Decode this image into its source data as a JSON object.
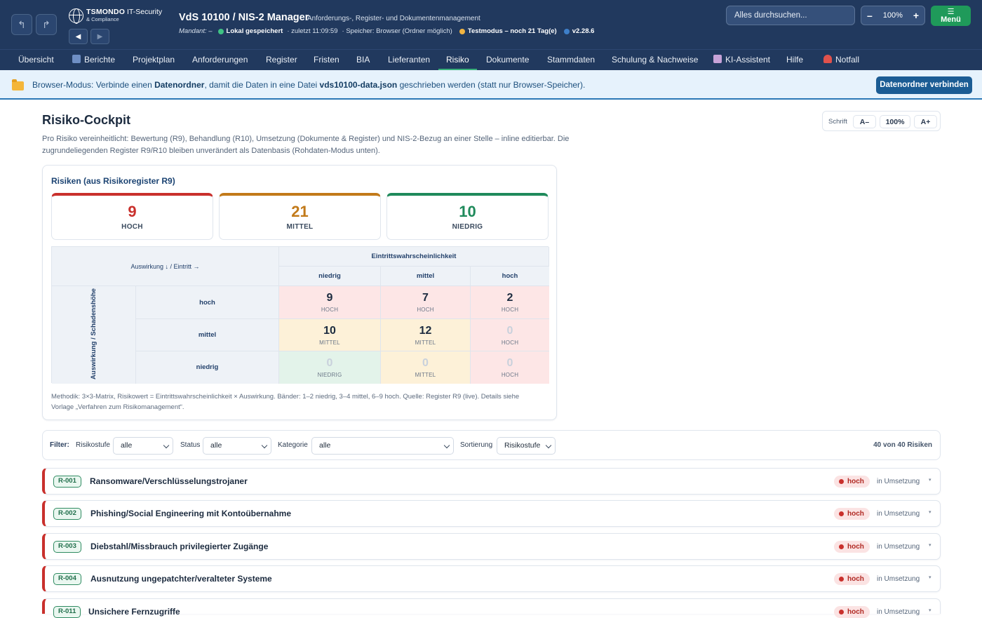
{
  "header": {
    "logo_name": "TSMONDO",
    "logo_it": "IT-Security",
    "logo_sub": "& Compliance",
    "title": "VdS 10100 / NIS-2 Manager",
    "subtitle": "Anforderungs-, Register- und Dokumentenmanagement",
    "mandant": "Mandant: –",
    "saved": "Lokal gespeichert",
    "last_saved": "· zuletzt 11:09:59",
    "storage": "· Speicher: Browser (Ordner möglich)",
    "testmode": "Testmodus – noch 21 Tag(e)",
    "version": "v2.28.6",
    "search_placeholder": "Alles durchsuchen...",
    "zoom_minus": "–",
    "zoom_value": "100%",
    "zoom_plus": "+",
    "menu_icon": "☰",
    "menu_label": "Menü",
    "colors": {
      "bg": "#21395e",
      "saved_dot": "#3fc384",
      "test_dot": "#f2b441",
      "version_dot": "#3e7fc9",
      "menu": "#1f9a5a"
    }
  },
  "tabs": [
    {
      "label": "Übersicht"
    },
    {
      "label": "Berichte",
      "icon": "chart-icon"
    },
    {
      "label": "Projektplan"
    },
    {
      "label": "Anforderungen"
    },
    {
      "label": "Register"
    },
    {
      "label": "Fristen"
    },
    {
      "label": "BIA"
    },
    {
      "label": "Lieferanten"
    },
    {
      "label": "Risiko",
      "active": true
    },
    {
      "label": "Dokumente"
    },
    {
      "label": "Stammdaten"
    },
    {
      "label": "Schulung & Nachweise"
    },
    {
      "label": "KI-Assistent",
      "icon": "robot-icon"
    },
    {
      "label": "Hilfe"
    },
    {
      "label": "Notfall",
      "icon": "siren-icon"
    }
  ],
  "banner": {
    "t1": "Browser-Modus: Verbinde einen ",
    "b1": "Datenordner",
    "t2": ", damit die Daten in eine Datei ",
    "b2": "vds10100-data.json",
    "t3": " geschrieben werden (statt nur Browser-Speicher).",
    "button": "Datenordner verbinden"
  },
  "page": {
    "title": "Risiko-Cockpit",
    "description": "Pro Risiko vereinheitlicht: Bewertung (R9), Behandlung (R10), Umsetzung (Dokumente & Register) und NIS-2-Bezug an einer Stelle – inline editierbar. Die zugrundeliegenden Register R9/R10 bleiben unverändert als Datenbasis (Rohdaten-Modus unten).",
    "font_label": "Schrift",
    "font_minus": "A–",
    "font_value": "100%",
    "font_plus": "A+"
  },
  "summary": {
    "title": "Risiken (aus Risikoregister R9)",
    "stats": [
      {
        "value": "9",
        "label": "HOCH",
        "color": "#c9302c"
      },
      {
        "value": "21",
        "label": "MITTEL",
        "color": "#c27a1a"
      },
      {
        "value": "10",
        "label": "NIEDRIG",
        "color": "#1f8a5b"
      }
    ]
  },
  "matrix": {
    "corner": "Auswirkung ↓ / Eintritt →",
    "col_group": "Eintrittswahrscheinlichkeit",
    "row_group": "Auswirkung / Schadenshöhe",
    "cols": [
      "niedrig",
      "mittel",
      "hoch"
    ],
    "rows": [
      {
        "label": "hoch",
        "cells": [
          {
            "value": "9",
            "band": "HOCH"
          },
          {
            "value": "7",
            "band": "HOCH"
          },
          {
            "value": "2",
            "band": "HOCH"
          }
        ]
      },
      {
        "label": "mittel",
        "cells": [
          {
            "value": "10",
            "band": "MITTEL"
          },
          {
            "value": "12",
            "band": "MITTEL"
          },
          {
            "value": "0",
            "band": "HOCH"
          }
        ]
      },
      {
        "label": "niedrig",
        "cells": [
          {
            "value": "0",
            "band": "NIEDRIG"
          },
          {
            "value": "0",
            "band": "MITTEL"
          },
          {
            "value": "0",
            "band": "HOCH"
          }
        ]
      }
    ],
    "band_colors": {
      "HOCH": "#fde6e6",
      "MITTEL": "#fdf1d8",
      "NIEDRIG": "#e3f3ea"
    },
    "methodik": "Methodik: 3×3-Matrix, Risikowert = Eintrittswahrscheinlichkeit × Auswirkung. Bänder: 1–2 niedrig, 3–4 mittel, 6–9 hoch. Quelle: Register R9 (live). Details siehe Vorlage „Verfahren zum Risikomanagement“."
  },
  "filters": {
    "label": "Filter:",
    "risk_label": "Risikostufe",
    "risk_value": "alle",
    "status_label": "Status",
    "status_value": "alle",
    "category_label": "Kategorie",
    "category_value": "alle",
    "sort_label": "Sortierung",
    "sort_value": "Risikostufe",
    "count": "40 von 40 Risiken"
  },
  "risks": [
    {
      "id": "R-001",
      "title": "Ransomware/Verschlüsselungstrojaner",
      "level": "hoch",
      "status": "in Umsetzung"
    },
    {
      "id": "R-002",
      "title": "Phishing/Social Engineering mit Kontoübernahme",
      "level": "hoch",
      "status": "in Umsetzung"
    },
    {
      "id": "R-003",
      "title": "Diebstahl/Missbrauch privilegierter Zugänge",
      "level": "hoch",
      "status": "in Umsetzung"
    },
    {
      "id": "R-004",
      "title": "Ausnutzung ungepatchter/veralteter Systeme",
      "level": "hoch",
      "status": "in Umsetzung"
    },
    {
      "id": "R-011",
      "title": "Unsichere Fernzugriffe",
      "level": "hoch",
      "status": "in Umsetzung"
    }
  ],
  "caret": "▾"
}
